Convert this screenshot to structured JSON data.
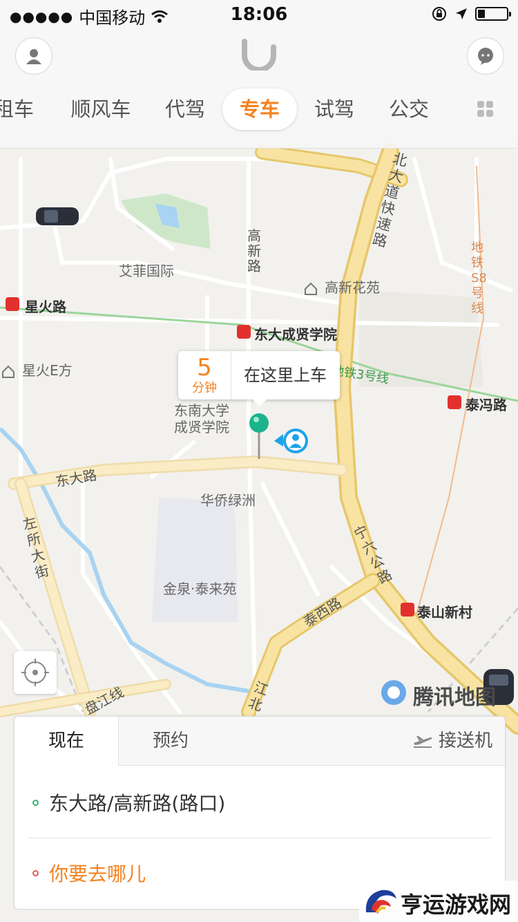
{
  "status_bar": {
    "carrier": "中国移动",
    "time": "18:06",
    "battery_level": 0.25
  },
  "header": {
    "tabs": [
      {
        "label": "租车"
      },
      {
        "label": "顺风车"
      },
      {
        "label": "代驾"
      },
      {
        "label": "专车",
        "active": true
      },
      {
        "label": "试驾"
      },
      {
        "label": "公交"
      }
    ]
  },
  "map": {
    "labels": {
      "aifei": "艾菲国际",
      "gaoxin_road": "高新路",
      "gaoxin_garden": "高新花苑",
      "xinghuo_road": "星火路",
      "dongda_chengxian": "东大成贤学院",
      "xinghuo_e": "星火E方",
      "dongnan_univ": "东南大学成贤学院",
      "metro3": "地铁3号线",
      "taifeng_road": "泰冯路",
      "beida_expressway": "北大道快速路",
      "metro_s8": "地铁S8号线",
      "dongda_road": "东大路",
      "huaqiao": "华侨绿洲",
      "zuosuo": "左所大街",
      "ningliu": "宁六公路",
      "jinquan": "金泉·泰来苑",
      "taixi_road": "泰西路",
      "taishan_village": "泰山新村",
      "panjiang": "盘江线",
      "jiangbei": "江北"
    },
    "watermark": "腾讯地图",
    "pickup": {
      "eta_value": "5",
      "eta_unit": "分钟",
      "text": "在这里上车"
    }
  },
  "card": {
    "tabs": {
      "now": "现在",
      "reserve": "预约",
      "airport": "接送机"
    },
    "origin": "东大路/高新路(路口)",
    "destination_placeholder": "你要去哪儿"
  },
  "corner_watermark": "亨运游戏网",
  "colors": {
    "accent": "#f58220",
    "origin_dot": "#3cb371",
    "destination_dot": "#e05c5c",
    "road_major": "#f6d98a",
    "metro_station": "#e2312d"
  }
}
